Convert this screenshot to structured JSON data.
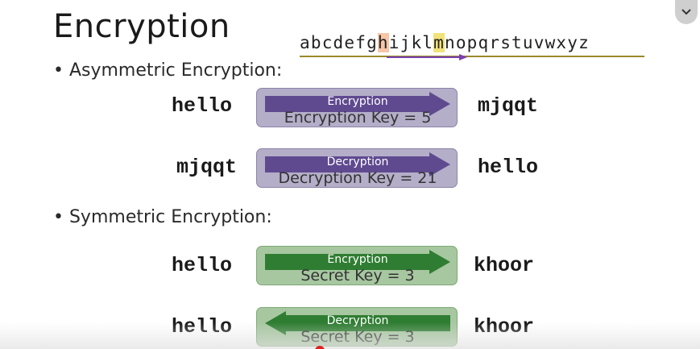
{
  "slide": {
    "title": "Encryption",
    "alphabet": [
      "a",
      "b",
      "c",
      "d",
      "e",
      "f",
      "g",
      "h",
      "i",
      "j",
      "k",
      "l",
      "m",
      "n",
      "o",
      "p",
      "q",
      "r",
      "s",
      "t",
      "u",
      "v",
      "w",
      "x",
      "y",
      "z"
    ],
    "highlight_letters": [
      "h",
      "m"
    ],
    "highlight_colors": {
      "h": "#f6c6a8",
      "m": "#f1e27a"
    },
    "sections": {
      "asymmetric": {
        "label": "• Asymmetric Encryption:",
        "rows": [
          {
            "input": "hello",
            "arrow": "Encryption",
            "key": "Encryption Key =  5",
            "output": "mjqqt",
            "direction": "right",
            "color": "#5f4a90"
          },
          {
            "input": "mjqqt",
            "arrow": "Decryption",
            "key": "Decryption Key = 21",
            "output": "hello",
            "direction": "right",
            "color": "#5f4a90"
          }
        ]
      },
      "symmetric": {
        "label": "• Symmetric Encryption:",
        "rows": [
          {
            "input": "hello",
            "arrow": "Encryption",
            "key": "Secret Key = 3",
            "output": "khoor",
            "direction": "right",
            "color": "#2f7d32"
          },
          {
            "input": "hello",
            "arrow": "Decryption",
            "key": "Secret Key = 3",
            "output": "khoor",
            "direction": "left",
            "color": "#2f7d32"
          }
        ]
      }
    }
  },
  "controls": {
    "scroll_icon": "chevron-down-icon"
  }
}
